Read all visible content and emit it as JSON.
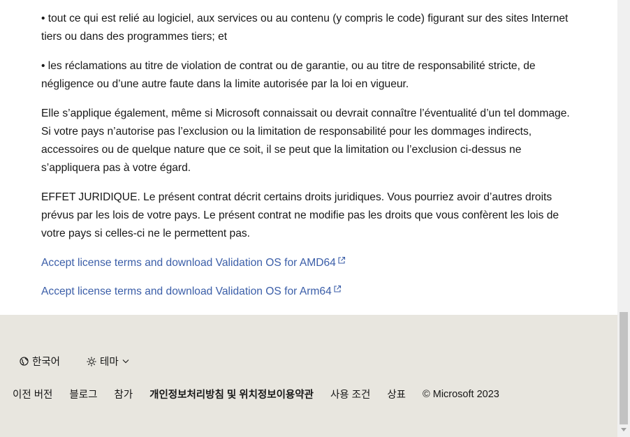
{
  "main": {
    "paragraphs": [
      "• tout ce qui est relié au logiciel, aux services ou au contenu (y compris le code) figurant sur des sites Internet tiers ou dans des programmes tiers; et",
      "• les réclamations au titre de violation de contrat ou de garantie, ou au titre de responsabilité stricte, de négligence ou d’une autre faute dans la limite autorisée par la loi en vigueur.",
      "Elle s’applique également, même si Microsoft connaissait ou devrait connaître l’éventualité d’un tel dommage. Si votre pays n’autorise pas l’exclusion ou la limitation de responsabilité pour les dommages indirects, accessoires ou de quelque nature que ce soit, il se peut que la limitation ou l’exclusion ci-dessus ne s’appliquera pas à votre égard.",
      "EFFET JURIDIQUE. Le présent contrat décrit certains droits juridiques. Vous pourriez avoir d’autres droits prévus par les lois de votre pays. Le présent contrat ne modifie pas les droits que vous confèrent les lois de votre pays si celles-ci ne le permettent pas."
    ],
    "links": [
      {
        "label": "Accept license terms and download Validation OS for AMD64",
        "icon": "external-link-icon"
      },
      {
        "label": "Accept license terms and download Validation OS for Arm64",
        "icon": "external-link-icon"
      }
    ]
  },
  "footer": {
    "locale_label": "한국어",
    "locale_icon": "globe-icon",
    "theme_label": "테마",
    "theme_icon": "sun-icon",
    "links": [
      "이전 버전",
      "블로그",
      "참가",
      "개인정보처리방침 및 위치정보이용약관",
      "사용 조건",
      "상표"
    ],
    "copyright": "© Microsoft 2023"
  },
  "colors": {
    "link": "#3b5ea8",
    "footer_bg": "#e8e6df",
    "text": "#171717"
  }
}
